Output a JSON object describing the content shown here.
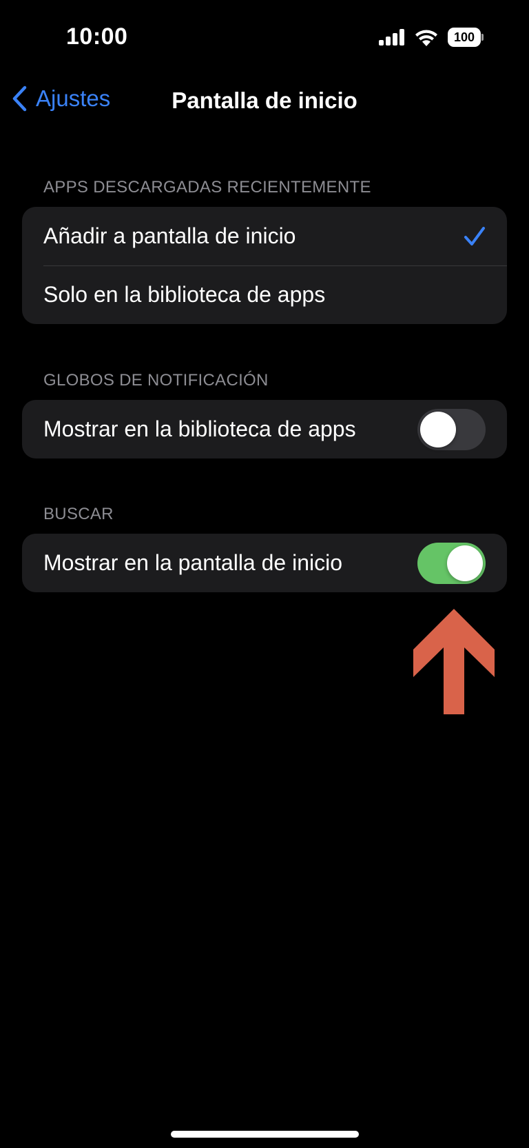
{
  "status_bar": {
    "time": "10:00",
    "battery_level": "100",
    "icons": [
      "cellular-signal-icon",
      "wifi-icon",
      "battery-icon"
    ]
  },
  "nav": {
    "back_label": "Ajustes",
    "title": "Pantalla de inicio"
  },
  "sections": [
    {
      "header": "APPS DESCARGADAS RECIENTEMENTE",
      "rows": [
        {
          "label": "Añadir a pantalla de inicio",
          "selected": true
        },
        {
          "label": "Solo en la biblioteca de apps",
          "selected": false
        }
      ]
    },
    {
      "header": "GLOBOS DE NOTIFICACIÓN",
      "rows": [
        {
          "label": "Mostrar en la biblioteca de apps",
          "toggle": false
        }
      ]
    },
    {
      "header": "BUSCAR",
      "rows": [
        {
          "label": "Mostrar en la pantalla de inicio",
          "toggle": true
        }
      ]
    }
  ],
  "colors": {
    "background": "#000000",
    "group_background": "#1c1c1e",
    "accent_blue": "#3a82f7",
    "toggle_on": "#65c466",
    "toggle_off": "#39393d",
    "section_header": "#8d8d93",
    "annotation_arrow": "#d9634a"
  }
}
